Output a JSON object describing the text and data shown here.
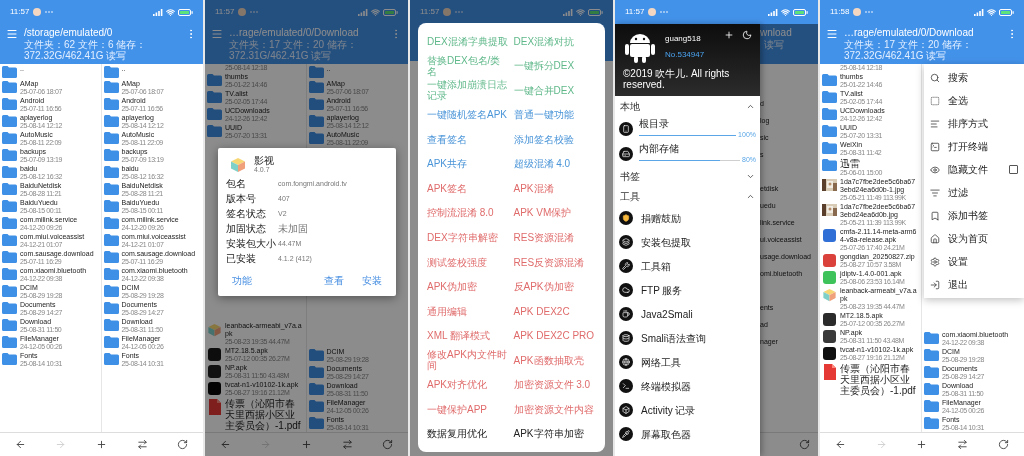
{
  "phones": [
    {
      "time": "11:57",
      "screen": {
        "kind": "files",
        "title": "/storage/emulated/0",
        "subtitle": "文件夹：62 文件：6 储存：372.32G/462.41G 读写",
        "forward_disabled": true,
        "panes": [
          {
            "top": [
              {
                "kind": "folder",
                "name": ".."
              },
              {
                "kind": "folder",
                "name": "AMap",
                "date": "25-07-06 18:07"
              },
              {
                "kind": "folder",
                "name": "Android",
                "date": "25-07-11 16:56"
              },
              {
                "kind": "folder",
                "name": "aplayerlog",
                "date": "25-08-14 12:12"
              },
              {
                "kind": "folder",
                "name": "AutoMusic",
                "date": "25-08-11 22:09"
              },
              {
                "kind": "folder",
                "name": "backups",
                "date": "25-07-09 13:19"
              },
              {
                "kind": "folder",
                "name": "baidu",
                "date": "25-08-12 16:32"
              },
              {
                "kind": "folder",
                "name": "BaiduNetdisk",
                "date": "25-08-28 11:21"
              },
              {
                "kind": "folder",
                "name": "BaiduYuedu",
                "date": "25-08-15 00:11"
              },
              {
                "kind": "folder",
                "name": "com.milink.service",
                "date": "24-12-20 09:26"
              },
              {
                "kind": "folder",
                "name": "com.miui.voiceassist",
                "date": "24-12-21 01:07"
              },
              {
                "kind": "folder",
                "name": "com.sausage.download",
                "date": "25-07-11 16:29"
              },
              {
                "kind": "folder",
                "name": "com.xiaomi.bluetooth",
                "date": "24-12-22 09:38"
              },
              {
                "kind": "folder",
                "name": "DCIM",
                "date": "25-08-29 19:28"
              },
              {
                "kind": "folder",
                "name": "Documents",
                "date": "25-08-29 14:27"
              },
              {
                "kind": "folder",
                "name": "Download",
                "date": "25-08-31 11:50"
              },
              {
                "kind": "folder",
                "name": "FileManager",
                "date": "24-12-05 00:26"
              },
              {
                "kind": "folder",
                "name": "Fonts",
                "date": "25-08-14 10:31"
              }
            ]
          },
          {
            "top": [
              {
                "kind": "folder",
                "name": ".."
              },
              {
                "kind": "folder",
                "name": "AMap",
                "date": "25-07-06 18:07"
              },
              {
                "kind": "folder",
                "name": "Android",
                "date": "25-07-11 16:56"
              },
              {
                "kind": "folder",
                "name": "aplayerlog",
                "date": "25-08-14 12:12"
              },
              {
                "kind": "folder",
                "name": "AutoMusic",
                "date": "25-08-11 22:09"
              },
              {
                "kind": "folder",
                "name": "backups",
                "date": "25-07-09 13:19"
              },
              {
                "kind": "folder",
                "name": "baidu",
                "date": "25-08-12 16:32"
              },
              {
                "kind": "folder",
                "name": "BaiduNetdisk",
                "date": "25-08-28 11:21"
              },
              {
                "kind": "folder",
                "name": "BaiduYuedu",
                "date": "25-08-15 00:11"
              },
              {
                "kind": "folder",
                "name": "com.milink.service",
                "date": "24-12-20 09:26"
              },
              {
                "kind": "folder",
                "name": "com.miui.voiceassist",
                "date": "24-12-21 01:07"
              },
              {
                "kind": "folder",
                "name": "com.sausage.download",
                "date": "25-07-11 16:29"
              },
              {
                "kind": "folder",
                "name": "com.xiaomi.bluetooth",
                "date": "24-12-22 09:38"
              },
              {
                "kind": "folder",
                "name": "DCIM",
                "date": "25-08-29 19:28"
              },
              {
                "kind": "folder",
                "name": "Documents",
                "date": "25-08-29 14:27"
              },
              {
                "kind": "folder",
                "name": "Download",
                "date": "25-08-31 11:50"
              },
              {
                "kind": "folder",
                "name": "FileManager",
                "date": "24-12-05 00:26"
              },
              {
                "kind": "folder",
                "name": "Fonts",
                "date": "25-08-14 10:31"
              }
            ]
          }
        ]
      }
    },
    {
      "time": "11:57",
      "dimmed": true,
      "screen": {
        "kind": "files",
        "title": "…rage/emulated/0/Download",
        "subtitle": "文件夹：17 文件：20 储存：372.31G/462.41G 读写",
        "forward_disabled": true,
        "panes": [
          {
            "top": [
              {
                "kind": "cut",
                "date": "25-08-14 12:18"
              },
              {
                "kind": "folder",
                "name": "thumbs",
                "date": "25-01-22 14:46"
              },
              {
                "kind": "folder",
                "name": "TV.alist",
                "date": "25-02-05 17:44"
              },
              {
                "kind": "folder",
                "name": "UCDownloads",
                "date": "24-12-26 12:42"
              },
              {
                "kind": "folder",
                "name": "UUID",
                "date": "25-07-20 13:31"
              }
            ],
            "bottom": [
              {
                "kind": "package",
                "name": "leanback-armeabi_v7a.apk",
                "date": "25-08-23 19:35 44.47M"
              },
              {
                "kind": "app",
                "color": "#181818",
                "name": "MT2.18.5.apk",
                "date": "25-07-12 00:35 26.27M"
              },
              {
                "kind": "app",
                "color": "#202020",
                "name": "NP.apk",
                "date": "25-08-31 11:50 43.48M"
              },
              {
                "kind": "app",
                "color": "#090909",
                "name": "tvcat-n1-v10102-1k.apk",
                "date": "25-08-27 19:16 21.12M"
              },
              {
                "kind": "pdf",
                "name": "传票（沁阳市春天里西据小区业主委员会）-1.pdf"
              }
            ]
          },
          {
            "top": [
              {
                "kind": "folder",
                "name": ".."
              },
              {
                "kind": "folder",
                "name": "AMap",
                "date": "25-07-06 18:07"
              },
              {
                "kind": "folder",
                "name": "Android",
                "date": "25-07-11 16:56"
              },
              {
                "kind": "folder",
                "name": "aplayerlog",
                "date": "25-08-14 12:12"
              },
              {
                "kind": "folder",
                "name": "AutoMusic",
                "date": "25-08-11 22:09"
              }
            ],
            "bottom": [
              {
                "kind": "folder",
                "name": "DCIM",
                "date": "25-08-29 19:28"
              },
              {
                "kind": "folder",
                "name": "Documents",
                "date": "25-08-29 14:27"
              },
              {
                "kind": "folder",
                "name": "Download",
                "date": "25-08-31 11:50"
              },
              {
                "kind": "folder",
                "name": "FileManager",
                "date": "24-12-05 00:26"
              },
              {
                "kind": "folder",
                "name": "Fonts",
                "date": "25-08-14 10:31"
              }
            ]
          }
        ]
      },
      "overlay": {
        "kind": "app_info",
        "name": "影视",
        "version": "4.0.7",
        "fields": [
          {
            "label": "包名",
            "value": "com.fongmi.android.tv"
          },
          {
            "label": "版本号",
            "value": "407"
          },
          {
            "label": "签名状态",
            "value": "V2"
          },
          {
            "label": "加固状态",
            "value": "未加固"
          },
          {
            "label": "安装包大小",
            "value": "44.47M"
          },
          {
            "label": "已安装",
            "value": "4.1.2 (412)"
          }
        ],
        "left_button": "功能",
        "right_buttons": [
          "查看",
          "安装"
        ]
      }
    },
    {
      "time": "11:57",
      "dimmed": true,
      "screen": {
        "kind": "covered"
      },
      "overlay": {
        "kind": "tools_menu",
        "items": [
          {
            "kind": "dex",
            "label": "DEX混淆字典提取"
          },
          {
            "kind": "dex",
            "label": "DEX混淆对抗"
          },
          {
            "kind": "dex",
            "label": "替换DEX包名/类名"
          },
          {
            "kind": "dex",
            "label": "一键拆分DEX"
          },
          {
            "kind": "dex",
            "label": "一键添加崩溃日志记录"
          },
          {
            "kind": "dex",
            "label": "一键合并DEX"
          },
          {
            "kind": "signature",
            "label": "一键随机签名APK"
          },
          {
            "kind": "signature",
            "label": "普通一键功能"
          },
          {
            "kind": "signature",
            "label": "查看签名"
          },
          {
            "kind": "signature",
            "label": "添加签名校验"
          },
          {
            "kind": "signature",
            "label": "APK共存"
          },
          {
            "kind": "signature",
            "label": "超级混淆 4.0"
          },
          {
            "kind": "protection",
            "label": "APK签名"
          },
          {
            "kind": "protection",
            "label": "APK混淆"
          },
          {
            "kind": "protection",
            "label": "控制流混淆 8.0"
          },
          {
            "kind": "protection",
            "label": "APK VM保护"
          },
          {
            "kind": "protection",
            "label": "DEX字符串解密"
          },
          {
            "kind": "protection",
            "label": "RES资源混淆"
          },
          {
            "kind": "protection",
            "label": "测试签校强度"
          },
          {
            "kind": "protection",
            "label": "RES反资源混淆"
          },
          {
            "kind": "protection",
            "label": "APK伪加密"
          },
          {
            "kind": "protection",
            "label": "反APK伪加密"
          },
          {
            "kind": "protection",
            "label": "通用编辑"
          },
          {
            "kind": "protection",
            "label": "APK DEX2C"
          },
          {
            "kind": "protection",
            "label": "XML 翻译模式"
          },
          {
            "kind": "protection",
            "label": "APK DEX2C PRO"
          },
          {
            "kind": "protection",
            "label": "修改APK内文件时间"
          },
          {
            "kind": "protection",
            "label": "APK函数抽取壳"
          },
          {
            "kind": "protection",
            "label": "APK对齐优化"
          },
          {
            "kind": "protection",
            "label": "加密资源文件 3.0"
          },
          {
            "kind": "protection",
            "label": "一键保护APP"
          },
          {
            "kind": "protection",
            "label": "加密资源文件内容"
          },
          {
            "kind": "plain",
            "label": "数据复用优化"
          },
          {
            "kind": "plain",
            "label": "APK字符串加密"
          }
        ]
      }
    },
    {
      "time": "11:57",
      "screen": {
        "kind": "drawer",
        "user": "guang518",
        "number": "No.534947",
        "copyright": "©2019 吹牛儿. All rights reserved.",
        "sections": [
          {
            "title": "本地",
            "expanded": true,
            "items": [
              {
                "kind": "storage",
                "label": "根目录",
                "level": 1,
                "reading": "100%"
              },
              {
                "kind": "storage",
                "label": "内部存储",
                "level": 0.8,
                "reading": "80%"
              }
            ]
          },
          {
            "title": "书签",
            "expanded": false
          },
          {
            "title": "工具",
            "expanded": true,
            "items": [
              {
                "kind": "tool",
                "label": "捐赠鼓励"
              },
              {
                "kind": "tool",
                "label": "安装包提取"
              },
              {
                "kind": "tool",
                "label": "工具箱"
              },
              {
                "kind": "tool",
                "label": "FTP 服务"
              },
              {
                "kind": "tool",
                "label": "Java2Smali"
              },
              {
                "kind": "tool",
                "label": "Smali语法查询"
              },
              {
                "kind": "tool",
                "label": "网络工具"
              },
              {
                "kind": "tool",
                "label": "终端模拟器"
              },
              {
                "kind": "tool",
                "label": "Activity 记录"
              },
              {
                "kind": "tool",
                "label": "屏幕取色器"
              }
            ]
          }
        ],
        "peek": {
          "title": "wnload",
          "subtitle": "读写",
          "rows": [
            {
              "kind": "blank"
            },
            {
              "kind": "blank"
            },
            {
              "kind": "text",
              "name": "d"
            },
            {
              "kind": "text",
              "name": "log"
            },
            {
              "kind": "text",
              "name": "sic"
            },
            {
              "kind": "text",
              "name": "s"
            },
            {
              "kind": "blank"
            },
            {
              "kind": "text",
              "name": "etdisk"
            },
            {
              "kind": "text",
              "name": "uedu"
            },
            {
              "kind": "text",
              "name": "link.service"
            },
            {
              "kind": "text",
              "name": "ui.voiceassist"
            },
            {
              "kind": "text",
              "name": "usage.download"
            },
            {
              "kind": "text",
              "name": "omi.bluetooth"
            },
            {
              "kind": "blank"
            },
            {
              "kind": "text",
              "name": "ents"
            },
            {
              "kind": "text",
              "name": "ad"
            },
            {
              "kind": "text",
              "name": "nager"
            }
          ]
        }
      }
    },
    {
      "time": "11:58",
      "screen": {
        "kind": "files",
        "title": "…rage/emulated/0/Download",
        "subtitle": "文件夹：17 文件：20 储存：372.32G/462.41G 读写",
        "forward_disabled": true,
        "panes": [
          {
            "top": [
              {
                "kind": "cut",
                "date": "25-08-14 12:18"
              },
              {
                "kind": "folder",
                "name": "thumbs",
                "date": "25-01-22 14:46"
              },
              {
                "kind": "folder",
                "name": "TV.alist",
                "date": "25-02-05 17:44"
              },
              {
                "kind": "folder",
                "name": "UCDownloads",
                "date": "24-12-26 12:42"
              },
              {
                "kind": "folder",
                "name": "UUID",
                "date": "25-07-20 13:31"
              },
              {
                "kind": "folder",
                "name": "WeiXin",
                "date": "25-08-31 11:42"
              },
              {
                "kind": "folder",
                "name": "迅雷",
                "date": "25-06-01 15:00"
              },
              {
                "name": "1da7c7fbe2dee5c6ba673ebd24ea6d0b-1.jpg",
                "date": "25-05-21 11:49 113.99K"
              },
              {
                "name": "1da7c7fbe2dee5c6ba673ebd24ea6d0b.jpg",
                "date": "25-05-21 11:39 113.99K"
              },
              {
                "kind": "app",
                "color": "#2f6fd6",
                "name": "cmfa-2.11.14-meta-arm64-v8a-release.apk",
                "date": "25-07-26 17:40 24.21M"
              },
              {
                "kind": "app",
                "color": "#d9413a",
                "name": "gongdian_20250827.zip",
                "date": "25-08-27 10:57 3.58M"
              },
              {
                "kind": "app",
                "color": "#3dc35a",
                "name": "jdiptv-1.4.0-001.apk",
                "date": "25-08-06 23:53 16.14M"
              },
              {
                "kind": "package",
                "name": "leanback-armeabi_v7a.apk",
                "date": "25-08-23 19:35 44.47M"
              },
              {
                "kind": "app",
                "color": "#2b2b2b",
                "name": "MT2.18.5.apk",
                "date": "25-07-12 00:35 26.27M"
              },
              {
                "kind": "app",
                "color": "#3a3a3a",
                "name": "NP.apk",
                "date": "25-08-31 11:50 43.48M"
              },
              {
                "kind": "app",
                "color": "#111111",
                "name": "tvcat-n1-v10102-1k.apk",
                "date": "25-08-27 19:16 21.12M"
              },
              {
                "kind": "pdf",
                "name": "传票（沁阳市春天里西据小区业主委员会）-1.pdf"
              }
            ]
          },
          {
            "bottom": [
              {
                "kind": "folder",
                "name": "com.xiaomi.bluetooth",
                "date": "24-12-22 09:38"
              },
              {
                "kind": "folder",
                "name": "DCIM",
                "date": "25-08-29 19:28"
              },
              {
                "kind": "folder",
                "name": "Documents",
                "date": "25-08-29 14:27"
              },
              {
                "kind": "folder",
                "name": "Download",
                "date": "25-08-31 11:50"
              },
              {
                "kind": "folder",
                "name": "FileManager",
                "date": "24-12-05 00:26"
              },
              {
                "kind": "folder",
                "name": "Fonts",
                "date": "25-08-14 10:31"
              }
            ]
          }
        ]
      },
      "overlay": {
        "kind": "popup_menu",
        "items": [
          {
            "kind": "action",
            "label": "搜索"
          },
          {
            "kind": "action",
            "label": "全选"
          },
          {
            "kind": "action",
            "label": "排序方式"
          },
          {
            "kind": "action",
            "label": "打开终端"
          },
          {
            "kind": "checkbox",
            "label": "隐藏文件",
            "checked": false
          },
          {
            "kind": "action",
            "label": "过滤"
          },
          {
            "kind": "action",
            "label": "添加书签"
          },
          {
            "kind": "action",
            "label": "设为首页"
          },
          {
            "kind": "action",
            "label": "设置"
          },
          {
            "kind": "action",
            "label": "退出"
          }
        ]
      }
    }
  ]
}
